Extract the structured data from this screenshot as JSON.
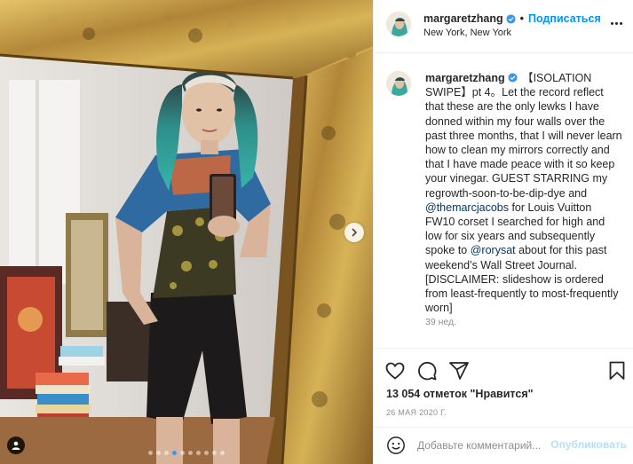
{
  "post": {
    "username": "margaretzhang",
    "follow_label": "Подписаться",
    "separator": "•",
    "location": "New York, New York",
    "more_icon": "more-horizontal-icon"
  },
  "caption": {
    "username": "margaretzhang",
    "text_1": " 【ISOLATION SWIPE】pt 4。Let the record reflect that these are the only lewks I have donned within my four walls over the past three months, that I will never learn how to clean my mirrors correctly and that I have made peace with it so keep your vinegar. GUEST STARRING my regrowth-soon-to-be-dip-dye and ",
    "mention_1": "@themarcjacobs",
    "text_2": " for Louis Vuitton FW10 corset I searched for high and low for six years and subsequently spoke to ",
    "mention_2": "@rorysat",
    "text_3": " about for this past weekend’s Wall Street Journal. [DISCLAIMER: slideshow is ordered from least-frequently to most-frequently worn]",
    "time": "39 нед."
  },
  "actions": {
    "likes": "13 054 отметок \"Нравится\"",
    "date": "26 МАЯ 2020 Г.",
    "icons": [
      "heart-icon",
      "comment-icon",
      "share-icon",
      "bookmark-icon"
    ]
  },
  "comment": {
    "placeholder": "Добавьте комментарий...",
    "post_label": "Опубликовать"
  },
  "media": {
    "slides_total": 10,
    "active_slide": 4
  },
  "colors": {
    "accent": "#0095f6",
    "verified": "#3897f0",
    "muted": "#8e8e8e",
    "post_disabled": "#b2dffc"
  }
}
